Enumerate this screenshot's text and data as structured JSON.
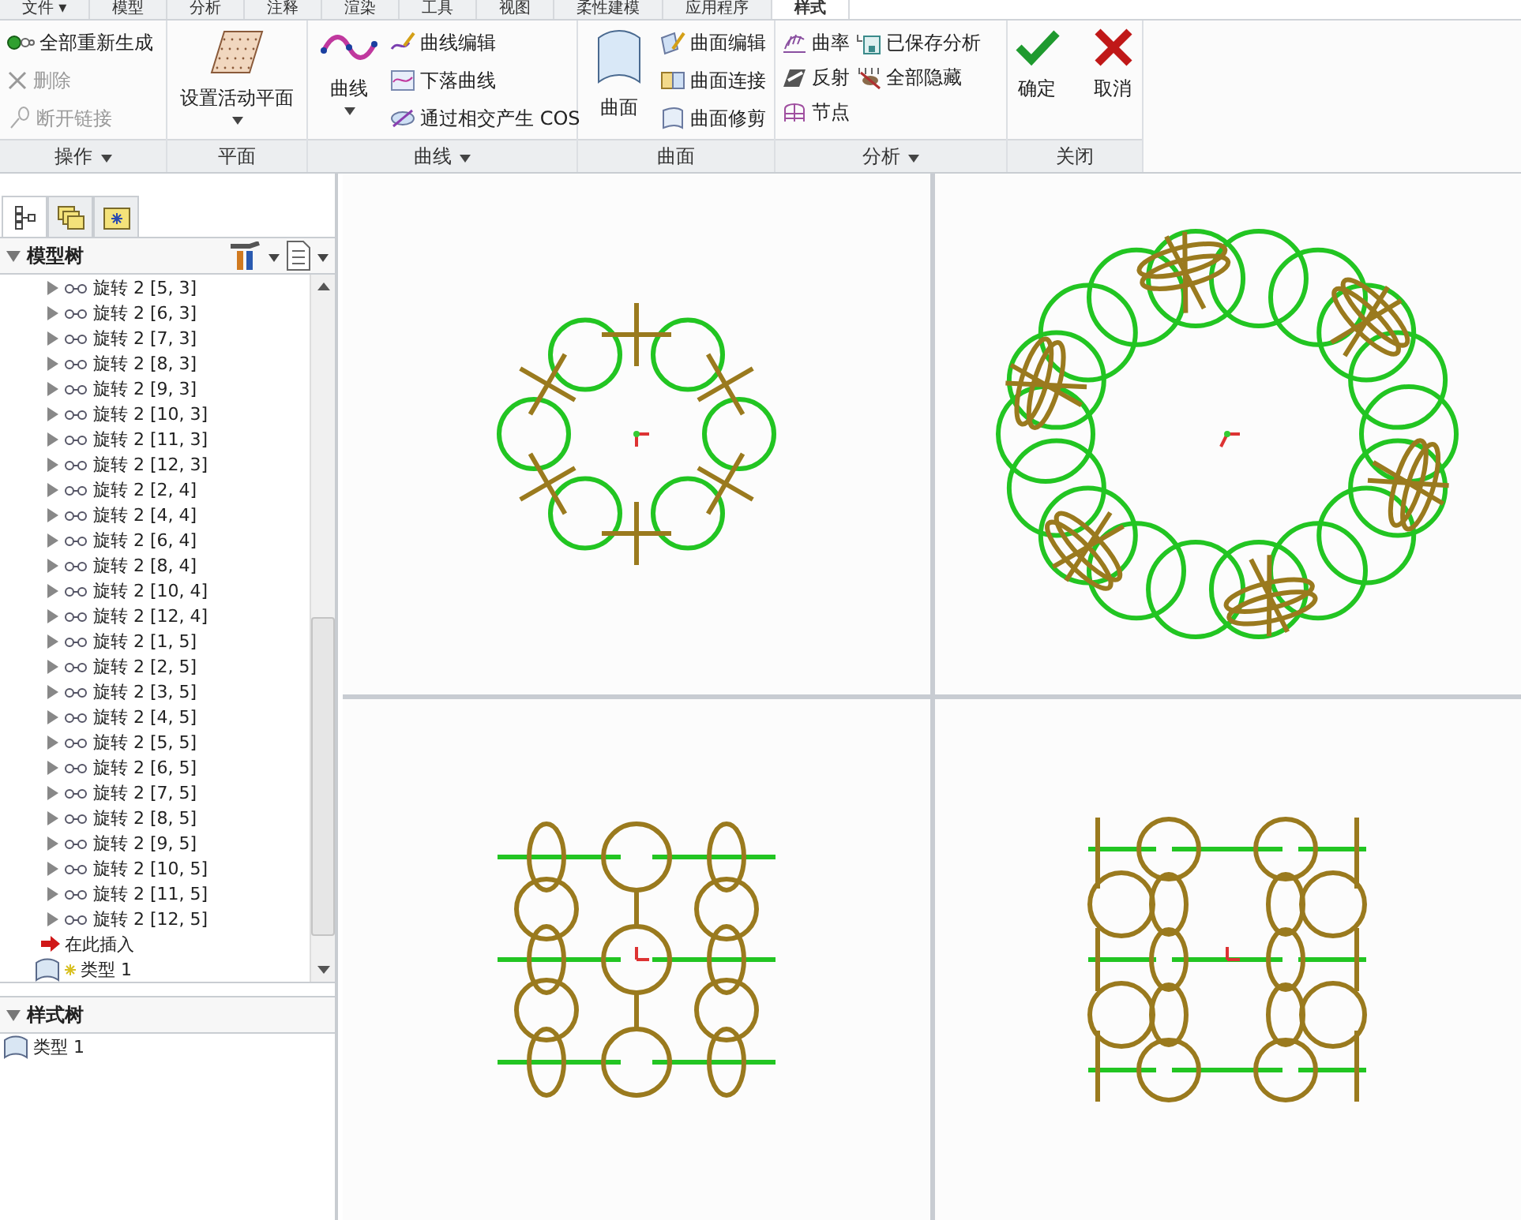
{
  "tabs": [
    {
      "label": "文件 ▾",
      "selected": false
    },
    {
      "label": "模型",
      "selected": false
    },
    {
      "label": "分析",
      "selected": false
    },
    {
      "label": "注释",
      "selected": false
    },
    {
      "label": "渲染",
      "selected": false
    },
    {
      "label": "工具",
      "selected": false
    },
    {
      "label": "视图",
      "selected": false
    },
    {
      "label": "柔性建模",
      "selected": false
    },
    {
      "label": "应用程序",
      "selected": false
    },
    {
      "label": "样式",
      "selected": true
    }
  ],
  "ribbon": {
    "groups": [
      {
        "label": "操作",
        "has_menu": true,
        "items": [
          {
            "label": "全部重新生成",
            "kind": "small",
            "disabled": false
          },
          {
            "label": "删除",
            "kind": "small",
            "disabled": true
          },
          {
            "label": "断开链接",
            "kind": "small",
            "disabled": true
          }
        ]
      },
      {
        "label": "平面",
        "has_menu": false,
        "items": [
          {
            "label": "设置活动平面",
            "kind": "large",
            "dropdown": true,
            "disabled": false
          }
        ]
      },
      {
        "label": "曲线",
        "has_menu": true,
        "items": [
          {
            "label": "曲线",
            "kind": "large",
            "dropdown": true,
            "disabled": false
          },
          {
            "label": "曲线编辑",
            "kind": "small",
            "disabled": false
          },
          {
            "label": "下落曲线",
            "kind": "small",
            "disabled": false
          },
          {
            "label": "通过相交产生 COS",
            "kind": "small",
            "disabled": false
          }
        ]
      },
      {
        "label": "曲面",
        "has_menu": false,
        "items": [
          {
            "label": "曲面",
            "kind": "large",
            "dropdown": false,
            "disabled": false
          },
          {
            "label": "曲面编辑",
            "kind": "small",
            "disabled": false
          },
          {
            "label": "曲面连接",
            "kind": "small",
            "disabled": false
          },
          {
            "label": "曲面修剪",
            "kind": "small",
            "disabled": false
          }
        ]
      },
      {
        "label": "分析",
        "has_menu": true,
        "items": [
          {
            "label": "曲率",
            "kind": "small",
            "disabled": false
          },
          {
            "label": "反射",
            "kind": "small",
            "disabled": false
          },
          {
            "label": "节点",
            "kind": "small",
            "disabled": false
          },
          {
            "label": "已保存分析",
            "kind": "small",
            "disabled": false
          },
          {
            "label": "全部隐藏",
            "kind": "small",
            "disabled": false
          }
        ]
      },
      {
        "label": "关闭",
        "has_menu": false,
        "items": [
          {
            "label": "确定",
            "kind": "large",
            "dropdown": false,
            "disabled": false
          },
          {
            "label": "取消",
            "kind": "large",
            "dropdown": false,
            "disabled": false
          }
        ]
      }
    ]
  },
  "panel_tabs": [
    {
      "selected": true
    },
    {
      "selected": false
    },
    {
      "selected": false
    }
  ],
  "model_tree": {
    "title": "模型树",
    "expanded": true,
    "rows": [
      {
        "label": "旋转 2 [5, 3]",
        "kind": "feature"
      },
      {
        "label": "旋转 2 [6, 3]",
        "kind": "feature"
      },
      {
        "label": "旋转 2 [7, 3]",
        "kind": "feature"
      },
      {
        "label": "旋转 2 [8, 3]",
        "kind": "feature"
      },
      {
        "label": "旋转 2 [9, 3]",
        "kind": "feature"
      },
      {
        "label": "旋转 2 [10, 3]",
        "kind": "feature"
      },
      {
        "label": "旋转 2 [11, 3]",
        "kind": "feature"
      },
      {
        "label": "旋转 2 [12, 3]",
        "kind": "feature"
      },
      {
        "label": "旋转 2 [2, 4]",
        "kind": "feature"
      },
      {
        "label": "旋转 2 [4, 4]",
        "kind": "feature"
      },
      {
        "label": "旋转 2 [6, 4]",
        "kind": "feature"
      },
      {
        "label": "旋转 2 [8, 4]",
        "kind": "feature"
      },
      {
        "label": "旋转 2 [10, 4]",
        "kind": "feature"
      },
      {
        "label": "旋转 2 [12, 4]",
        "kind": "feature"
      },
      {
        "label": "旋转 2 [1, 5]",
        "kind": "feature"
      },
      {
        "label": "旋转 2 [2, 5]",
        "kind": "feature"
      },
      {
        "label": "旋转 2 [3, 5]",
        "kind": "feature"
      },
      {
        "label": "旋转 2 [4, 5]",
        "kind": "feature"
      },
      {
        "label": "旋转 2 [5, 5]",
        "kind": "feature"
      },
      {
        "label": "旋转 2 [6, 5]",
        "kind": "feature"
      },
      {
        "label": "旋转 2 [7, 5]",
        "kind": "feature"
      },
      {
        "label": "旋转 2 [8, 5]",
        "kind": "feature"
      },
      {
        "label": "旋转 2 [9, 5]",
        "kind": "feature"
      },
      {
        "label": "旋转 2 [10, 5]",
        "kind": "feature"
      },
      {
        "label": "旋转 2 [11, 5]",
        "kind": "feature"
      },
      {
        "label": "旋转 2 [12, 5]",
        "kind": "feature"
      },
      {
        "label": "在此插入",
        "kind": "insert"
      },
      {
        "label": "类型 1",
        "kind": "style"
      }
    ]
  },
  "style_tree": {
    "title": "样式树",
    "expanded": true,
    "rows": [
      {
        "label": "类型 1",
        "kind": "style"
      }
    ]
  }
}
